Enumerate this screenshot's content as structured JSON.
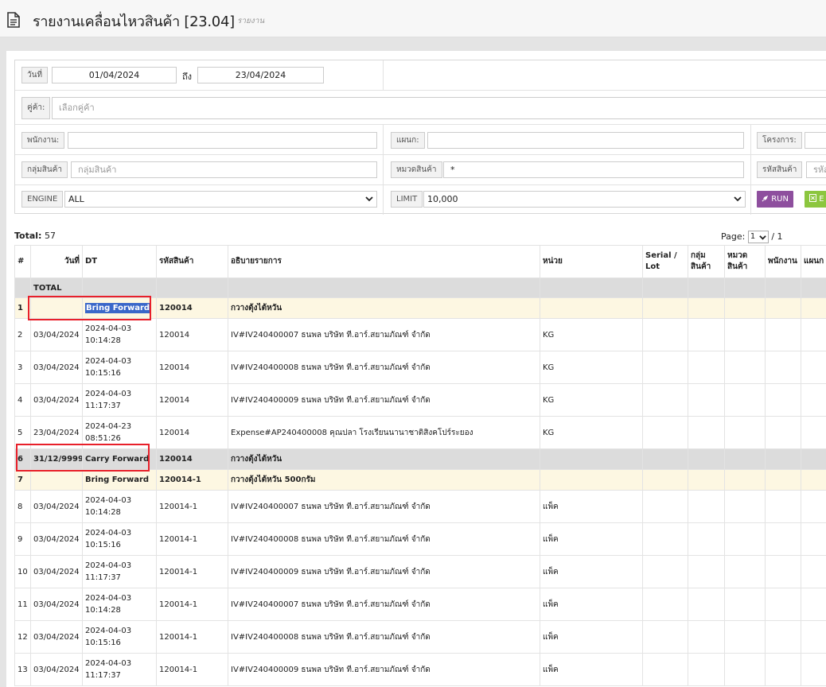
{
  "header": {
    "title": "รายงานเคลื่อนไหวสินค้า [23.04]",
    "subtitle": "รายงาน",
    "icon": "document-icon"
  },
  "filters": {
    "date_label": "วันที่",
    "date_from": "01/04/2024",
    "to_label": "ถึง",
    "date_to": "23/04/2024",
    "customer_label": "คู่ค้า:",
    "customer_placeholder": "เลือกคู่ค้า",
    "employee_label": "พนักงาน:",
    "employee_value": "",
    "department_label": "แผนก:",
    "department_value": "",
    "project_label": "โครงการ:",
    "product_group_label": "กลุ่มสินค้า",
    "product_group_placeholder": "กลุ่มสินค้า",
    "product_category_label": "หมวดสินค้า",
    "product_category_value": "*",
    "product_code_label": "รหัสสินค้า",
    "product_code_placeholder": "รหัส",
    "engine_label": "ENGINE",
    "engine_value": "ALL",
    "limit_label": "LIMIT",
    "limit_value": "10,000",
    "run_label": "RUN",
    "export_label": "E"
  },
  "summary": {
    "total_label": "Total:",
    "total_value": "57",
    "page_label": "Page:",
    "page_value": "1",
    "page_of": "/ 1"
  },
  "table": {
    "columns": [
      "#",
      "วันที่",
      "DT",
      "รหัสสินค้า",
      "อธิบายรายการ",
      "หน่วย",
      "Serial / Lot",
      "กลุ่ม สินค้า",
      "หมวด สินค้า",
      "พนักงาน",
      "แผนก"
    ],
    "total_row_label": "TOTAL",
    "rows": [
      {
        "kind": "bf",
        "no": "1",
        "date": "",
        "dt": "Bring Forward",
        "dt2": "",
        "code": "120014",
        "desc": "กวางตุ้งไต้หวัน",
        "unit": ""
      },
      {
        "kind": "data",
        "no": "2",
        "date": "03/04/2024",
        "dt": "2024-04-03",
        "dt2": "10:14:28",
        "code": "120014",
        "desc": "IV#IV240400007 ธนพล บริษัท ที.อาร์.สยามภัณฑ์ จำกัด",
        "unit": "KG"
      },
      {
        "kind": "data",
        "no": "3",
        "date": "03/04/2024",
        "dt": "2024-04-03",
        "dt2": "10:15:16",
        "code": "120014",
        "desc": "IV#IV240400008 ธนพล บริษัท ที.อาร์.สยามภัณฑ์ จำกัด",
        "unit": "KG"
      },
      {
        "kind": "data",
        "no": "4",
        "date": "03/04/2024",
        "dt": "2024-04-03",
        "dt2": "11:17:37",
        "code": "120014",
        "desc": "IV#IV240400009 ธนพล บริษัท ที.อาร์.สยามภัณฑ์ จำกัด",
        "unit": "KG"
      },
      {
        "kind": "data",
        "no": "5",
        "date": "23/04/2024",
        "dt": "2024-04-23",
        "dt2": "08:51:26",
        "code": "120014",
        "desc": "Expense#AP240400008 คุณปลา โรงเรียนนานาชาติสิงคโปร์ระยอง",
        "unit": "KG"
      },
      {
        "kind": "cf",
        "no": "6",
        "date": "31/12/9999",
        "dt": "Carry Forward",
        "dt2": "",
        "code": "120014",
        "desc": "กวางตุ้งไต้หวัน",
        "unit": ""
      },
      {
        "kind": "bf",
        "no": "7",
        "date": "",
        "dt": "Bring Forward",
        "dt2": "",
        "code": "120014-1",
        "desc": "กวางตุ้งไต้หวัน 500กรัม",
        "unit": ""
      },
      {
        "kind": "data",
        "no": "8",
        "date": "03/04/2024",
        "dt": "2024-04-03",
        "dt2": "10:14:28",
        "code": "120014-1",
        "desc": "IV#IV240400007 ธนพล บริษัท ที.อาร์.สยามภัณฑ์ จำกัด",
        "unit": "แพ็ค"
      },
      {
        "kind": "data",
        "no": "9",
        "date": "03/04/2024",
        "dt": "2024-04-03",
        "dt2": "10:15:16",
        "code": "120014-1",
        "desc": "IV#IV240400008 ธนพล บริษัท ที.อาร์.สยามภัณฑ์ จำกัด",
        "unit": "แพ็ค"
      },
      {
        "kind": "data",
        "no": "10",
        "date": "03/04/2024",
        "dt": "2024-04-03",
        "dt2": "11:17:37",
        "code": "120014-1",
        "desc": "IV#IV240400009 ธนพล บริษัท ที.อาร์.สยามภัณฑ์ จำกัด",
        "unit": "แพ็ค"
      },
      {
        "kind": "data",
        "no": "11",
        "date": "03/04/2024",
        "dt": "2024-04-03",
        "dt2": "10:14:28",
        "code": "120014-1",
        "desc": "IV#IV240400007 ธนพล บริษัท ที.อาร์.สยามภัณฑ์ จำกัด",
        "unit": "แพ็ค"
      },
      {
        "kind": "data",
        "no": "12",
        "date": "03/04/2024",
        "dt": "2024-04-03",
        "dt2": "10:15:16",
        "code": "120014-1",
        "desc": "IV#IV240400008 ธนพล บริษัท ที.อาร์.สยามภัณฑ์ จำกัด",
        "unit": "แพ็ค"
      },
      {
        "kind": "data",
        "no": "13",
        "date": "03/04/2024",
        "dt": "2024-04-03",
        "dt2": "11:17:37",
        "code": "120014-1",
        "desc": "IV#IV240400009 ธนพล บริษัท ที.อาร์.สยามภัณฑ์ จำกัด",
        "unit": "แพ็ค"
      }
    ]
  },
  "colors": {
    "run_button": "#8e4f9e",
    "export_button": "#8cc63f",
    "bring_forward_row": "#fdf7e2",
    "carry_forward_row": "#dcdcdc",
    "annotation_box": "#e8202a",
    "selection": "#3a67c9"
  }
}
